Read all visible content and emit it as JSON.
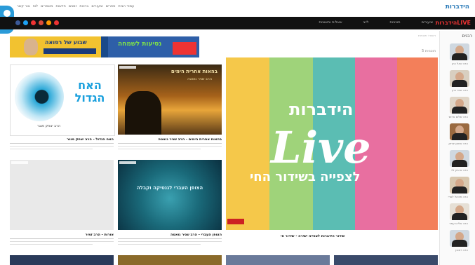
{
  "topbar": {
    "links": [
      "עמוד הבית",
      "ספרים",
      "שיעורים",
      "ברכות",
      "זמנים",
      "חדשות",
      "מאמרים",
      "לוח",
      "צור קשר"
    ],
    "logo_main": "הידברות",
    "logo_accent": ""
  },
  "navbar": {
    "items": [
      "שיעורים",
      "תוכניות",
      "לייב",
      "שאלות ותשובות"
    ],
    "logo": "הידברותLIVE"
  },
  "ad": {
    "left_text": "שבוע של רפואה",
    "right_text": "נסיעות לשמחה",
    "colors": {
      "left_bg": "#f2c230",
      "right_bg": "#2e5fa8",
      "accent": "#7ee04a"
    }
  },
  "page": {
    "breadcrumb": "ראשי › תוכניות",
    "section_title": "5 תוכניות"
  },
  "sidebar": {
    "label": "רבנים",
    "rabbis": [
      {
        "name": "הרב יגאל כהן"
      },
      {
        "name": "הרב זמיר כהן"
      },
      {
        "name": "הרב שלום ארוש"
      },
      {
        "name": "הרב אמנון יצחק"
      },
      {
        "name": "הרב אהרון לוי"
      },
      {
        "name": "הרב מיכאל לסרי"
      },
      {
        "name": "הרב אליהו עמר"
      },
      {
        "name": "הרב ראובן"
      }
    ]
  },
  "cards": [
    {
      "title": "האח הגדול - הרב יצחק פנגר",
      "thumb_text": "האח הגדול",
      "thumb_sub": "הרב יצחק פנגר"
    },
    {
      "title": "בהאות אחרית הימים - הרב שניר גואטה",
      "thumb_text": "בהאות אחרית הימים",
      "thumb_sub": "הרב שניר גואטה"
    },
    {
      "title": "אורות - הרב זמיר",
      "thumb_text": "",
      "thumb_sub": ""
    },
    {
      "title": "הצופן העברי - הרב שניר גואטה",
      "thumb_text": "הצופן העברי לגנטיקה וקבלה",
      "thumb_sub": ""
    }
  ],
  "featured": {
    "line1": "הידברות",
    "line2": "Live",
    "line3": "לצפייה בשידור החי",
    "caption": "שידור הידברות לצפייה ישירה - שידור חי",
    "stripe_colors": [
      "#f5c84a",
      "#9fd37a",
      "#5bbdb3",
      "#e86fa0",
      "#f37f5a"
    ]
  }
}
